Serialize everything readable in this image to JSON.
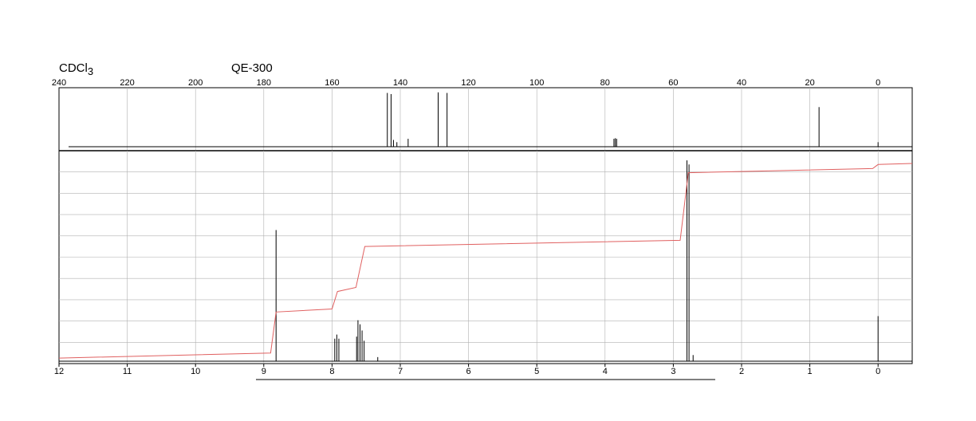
{
  "header": {
    "solvent": "CDCl",
    "solvent_subscript": "3",
    "instrument": "QE-300"
  },
  "colors": {
    "spectrum": "#000000",
    "integral": "#e06060",
    "grid": "#b0b0b0"
  },
  "chart_data": [
    {
      "type": "line",
      "panel": "13C NMR",
      "title": "",
      "xlabel": "",
      "ylabel": "",
      "x_axis_position": "top",
      "x_reversed": true,
      "xlim": [
        240,
        -10
      ],
      "ylim": [
        0,
        1
      ],
      "grid": true,
      "x_ticks": [
        "240",
        "220",
        "200",
        "180",
        "160",
        "140",
        "120",
        "100",
        "80",
        "60",
        "40",
        "20",
        "0"
      ],
      "series": [
        {
          "peaks": [
            {
              "x": 143.8,
              "y": 0.95
            },
            {
              "x": 142.7,
              "y": 0.93
            },
            {
              "x": 142.0,
              "y": 0.12
            },
            {
              "x": 141.0,
              "y": 0.08
            },
            {
              "x": 137.7,
              "y": 0.14
            },
            {
              "x": 128.9,
              "y": 0.96
            },
            {
              "x": 126.3,
              "y": 0.95
            },
            {
              "x": 77.4,
              "y": 0.14
            },
            {
              "x": 77.0,
              "y": 0.15
            },
            {
              "x": 76.6,
              "y": 0.14
            },
            {
              "x": 17.3,
              "y": 0.7
            },
            {
              "x": 0.0,
              "y": 0.08
            }
          ]
        }
      ]
    },
    {
      "type": "line",
      "panel": "1H NMR",
      "title": "",
      "xlabel": "",
      "ylabel": "",
      "x_axis_position": "bottom",
      "x_reversed": true,
      "xlim": [
        12,
        -0.5
      ],
      "ylim": [
        0,
        1
      ],
      "grid": true,
      "x_ticks": [
        "12",
        "11",
        "10",
        "9",
        "8",
        "7",
        "6",
        "5",
        "4",
        "3",
        "2",
        "1",
        "0"
      ],
      "series": [
        {
          "peaks": [
            {
              "x": 8.82,
              "y": 0.64
            },
            {
              "x": 7.96,
              "y": 0.11
            },
            {
              "x": 7.93,
              "y": 0.13
            },
            {
              "x": 7.9,
              "y": 0.11
            },
            {
              "x": 7.64,
              "y": 0.12
            },
            {
              "x": 7.62,
              "y": 0.2
            },
            {
              "x": 7.59,
              "y": 0.18
            },
            {
              "x": 7.56,
              "y": 0.15
            },
            {
              "x": 7.53,
              "y": 0.1
            },
            {
              "x": 7.33,
              "y": 0.02
            },
            {
              "x": 2.8,
              "y": 0.98
            },
            {
              "x": 2.77,
              "y": 0.96
            },
            {
              "x": 2.71,
              "y": 0.03
            },
            {
              "x": 0.0,
              "y": 0.22
            }
          ]
        },
        {
          "integral": [
            {
              "x": 12.0,
              "y": 0.015
            },
            {
              "x": 8.9,
              "y": 0.04
            },
            {
              "x": 8.82,
              "y": 0.24
            },
            {
              "x": 8.0,
              "y": 0.255
            },
            {
              "x": 7.92,
              "y": 0.34
            },
            {
              "x": 7.65,
              "y": 0.36
            },
            {
              "x": 7.52,
              "y": 0.56
            },
            {
              "x": 2.9,
              "y": 0.59
            },
            {
              "x": 2.78,
              "y": 0.92
            },
            {
              "x": 0.08,
              "y": 0.94
            },
            {
              "x": 0.0,
              "y": 0.96
            },
            {
              "x": -0.5,
              "y": 0.965
            }
          ]
        }
      ]
    }
  ]
}
